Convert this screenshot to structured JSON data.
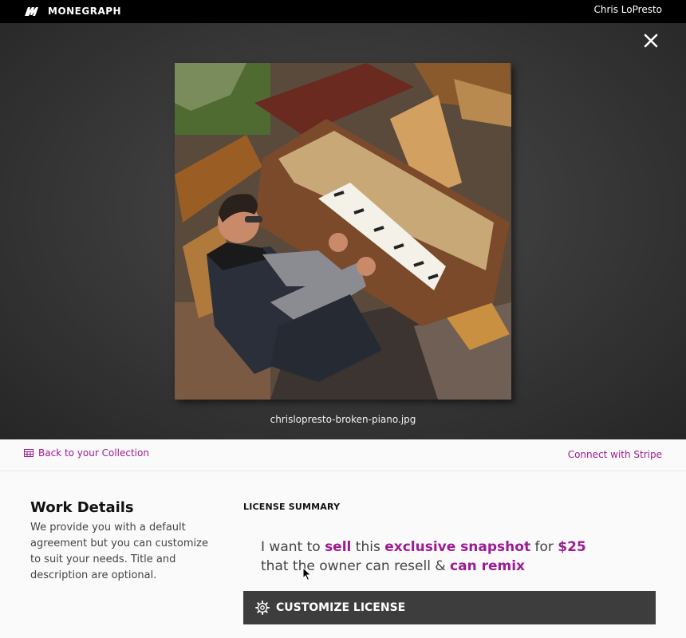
{
  "topbar": {
    "brand": "MONEGRAPH",
    "user_name": "Chris LoPresto"
  },
  "viewer": {
    "filename": "chrislopresto-broken-piano.jpg",
    "close_icon": "close-icon"
  },
  "actionbar": {
    "back_label": "Back to your Collection",
    "back_icon": "collection-grid-icon",
    "stripe_label": "Connect with Stripe"
  },
  "work_details": {
    "title": "Work Details",
    "description": "We provide you with a default agreement but you can customize to suit your needs. Title and description are optional."
  },
  "license": {
    "title": "LICENSE SUMMARY",
    "sentence": {
      "p1": "I want to ",
      "action": "sell",
      "p2": " this ",
      "kind": "exclusive snapshot",
      "p3": " for ",
      "price": "$25",
      "p4": "that the owner can resell & ",
      "remix": "can remix"
    },
    "customize_label": "CUSTOMIZE LICENSE",
    "customize_icon": "gear-icon"
  },
  "colors": {
    "accent": "#9c1b93",
    "topbar": "#000000",
    "button": "#3d3d3d"
  }
}
